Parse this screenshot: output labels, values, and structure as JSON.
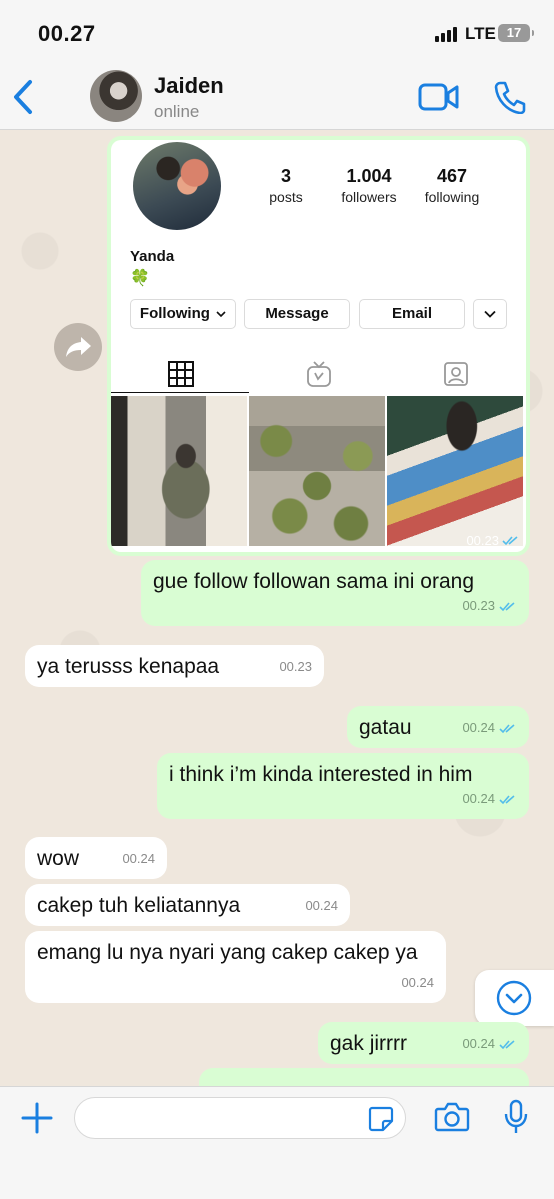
{
  "status_bar": {
    "time": "00.27",
    "network": "LTE",
    "battery": "17"
  },
  "header": {
    "contact_name": "Jaiden",
    "contact_status": "online"
  },
  "instagram_card": {
    "stats": [
      {
        "num": "3",
        "label": "posts"
      },
      {
        "num": "1.004",
        "label": "followers"
      },
      {
        "num": "467",
        "label": "following"
      }
    ],
    "name": "Yanda",
    "bio_emoji": "🍀",
    "buttons": {
      "following": "Following",
      "message": "Message",
      "email": "Email"
    },
    "timestamp": "00.23"
  },
  "messages": [
    {
      "text": "gue follow followan sama ini orang",
      "time": "00.23",
      "direction": "out"
    },
    {
      "text": "ya terusss kenapaa",
      "time": "00.23",
      "direction": "in"
    },
    {
      "text": "gatau",
      "time": "00.24",
      "direction": "out"
    },
    {
      "text": "i think i’m kinda interested in him",
      "time": "00.24",
      "direction": "out"
    },
    {
      "text": "wow",
      "time": "00.24",
      "direction": "in"
    },
    {
      "text": "cakep tuh keliatannya",
      "time": "00.24",
      "direction": "in"
    },
    {
      "text": "emang lu nya nyari yang cakep cakep ya",
      "time": "00.24",
      "direction": "in"
    },
    {
      "text": "gak jirrrr",
      "time": "00.24",
      "direction": "out"
    }
  ],
  "input": {
    "placeholder": ""
  },
  "colors": {
    "accent": "#1a7fe0",
    "outgoing_bubble": "#d9fdd3",
    "incoming_bubble": "#ffffff",
    "chat_bg": "#efe7dd",
    "read_tick": "#53bdeb"
  }
}
